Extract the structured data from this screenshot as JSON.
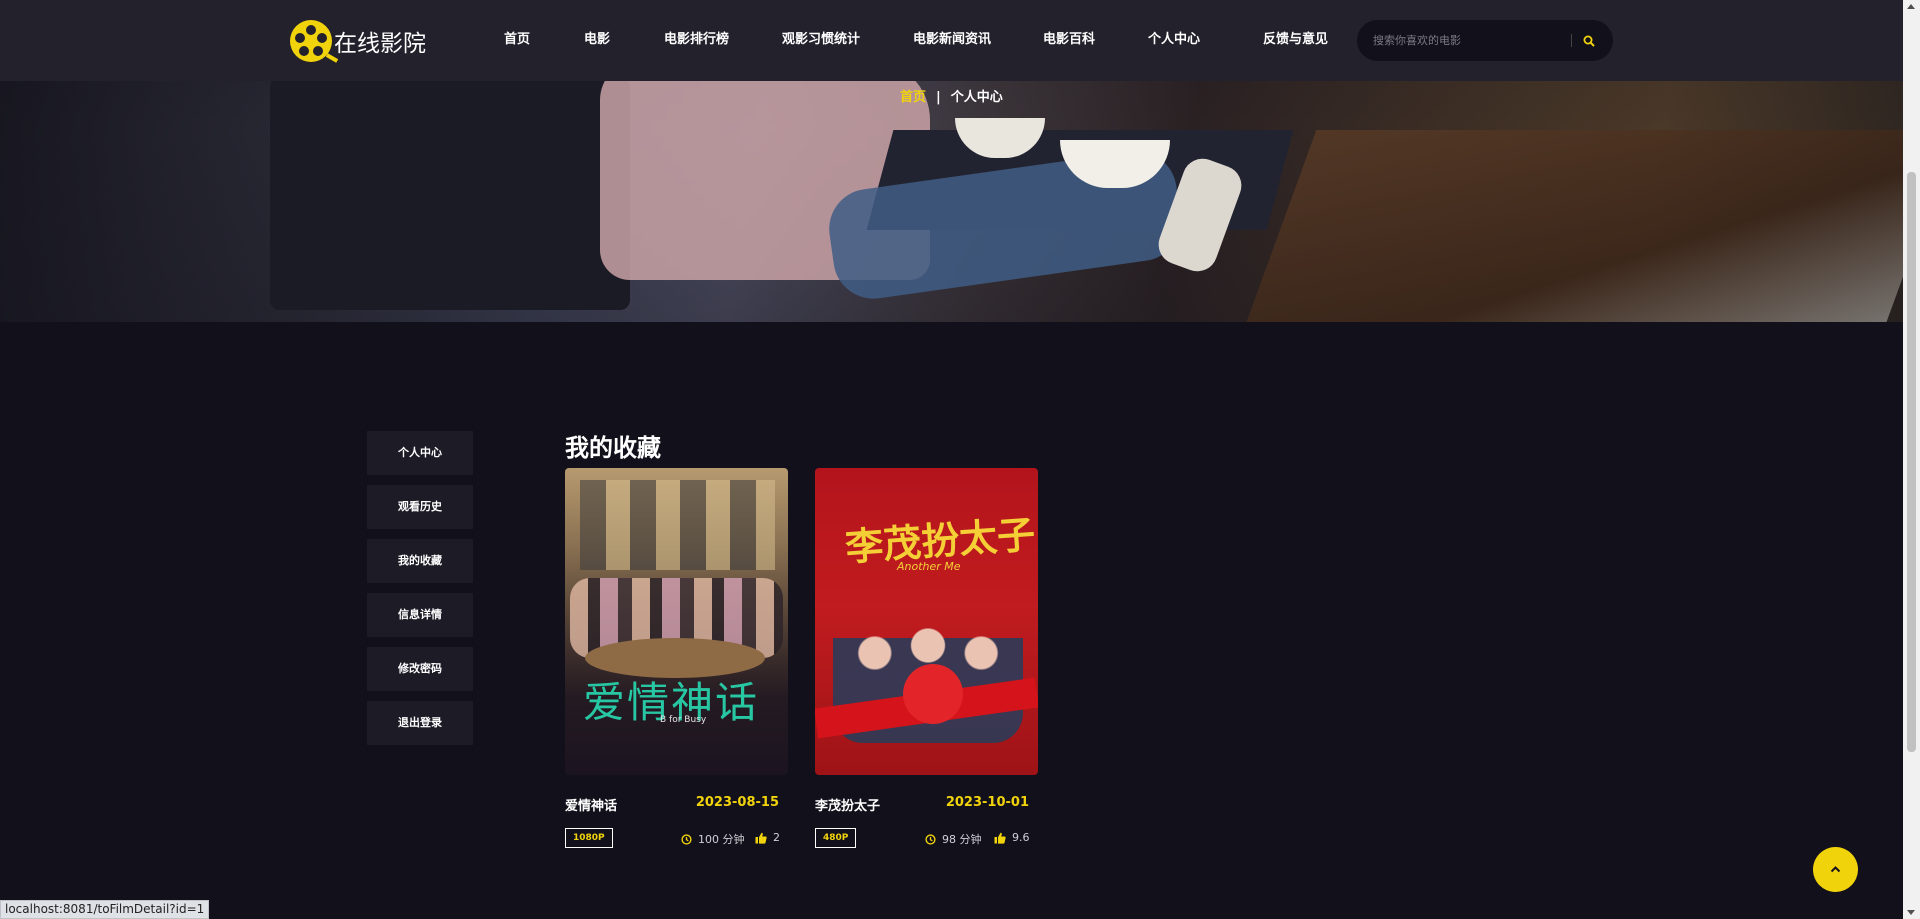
{
  "header": {
    "logo_text": "在线影院",
    "nav": [
      {
        "label": "首页"
      },
      {
        "label": "电影"
      },
      {
        "label": "电影排行榜"
      },
      {
        "label": "观影习惯统计"
      },
      {
        "label": "电影新闻资讯"
      },
      {
        "label": "电影百科"
      },
      {
        "label": "个人中心"
      },
      {
        "label": "反馈与意见"
      }
    ],
    "search": {
      "placeholder": "搜索你喜欢的电影",
      "icon": "search-icon"
    }
  },
  "breadcrumb": {
    "home": "首页",
    "separator": "|",
    "current": "个人中心"
  },
  "sidebar": {
    "items": [
      {
        "label": "个人中心"
      },
      {
        "label": "观看历史"
      },
      {
        "label": "我的收藏"
      },
      {
        "label": "信息详情"
      },
      {
        "label": "修改密码"
      },
      {
        "label": "退出登录"
      }
    ]
  },
  "main": {
    "title": "我的收藏",
    "films": [
      {
        "poster_title": "爱情神话",
        "poster_subtitle": "B for Busy",
        "name": "爱情神话",
        "date": "2023-08-15",
        "quality": "1080P",
        "duration": "100 分钟",
        "likes": "2"
      },
      {
        "poster_title": "李茂扮太子",
        "poster_subtitle": "Another Me",
        "name": "李茂扮太子",
        "date": "2023-10-01",
        "quality": "480P",
        "duration": "98 分钟",
        "likes": "9.6"
      }
    ]
  },
  "status_bar": {
    "url": "localhost:8081/toFilmDetail?id=1"
  },
  "colors": {
    "accent": "#f1d30c",
    "background": "#12111b",
    "header": "#22212c"
  }
}
